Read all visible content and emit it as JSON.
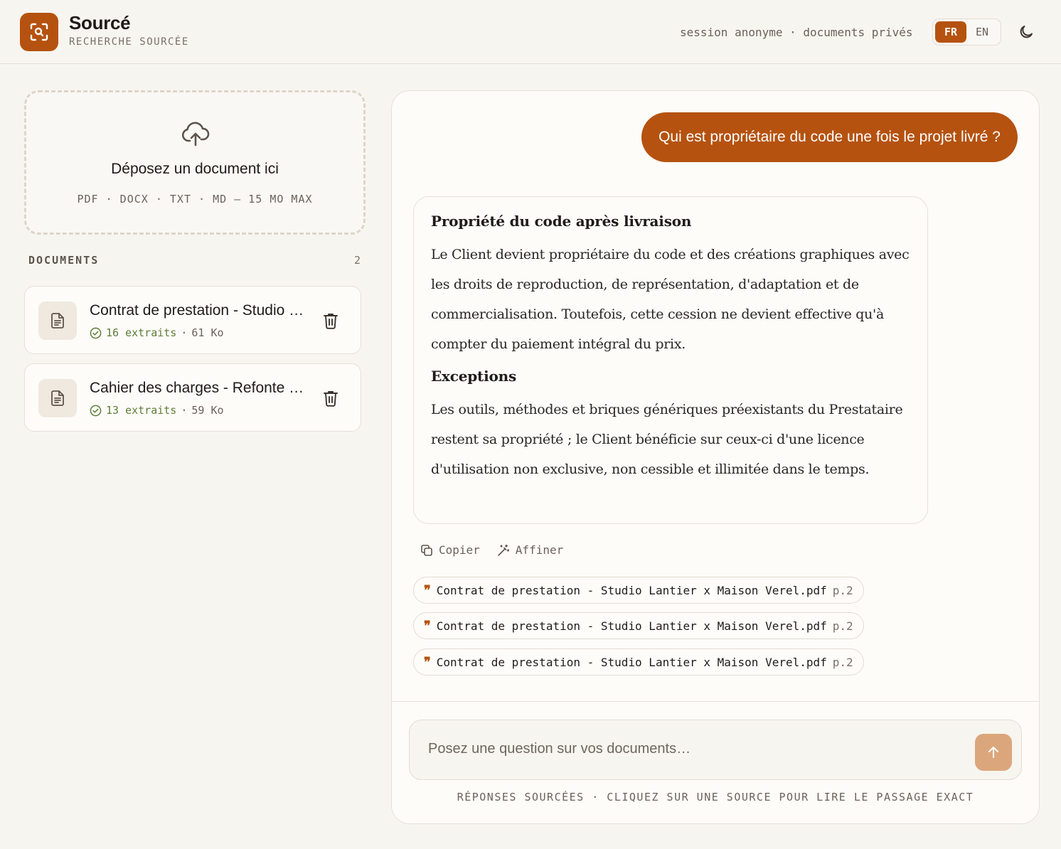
{
  "header": {
    "brand_title": "Sourcé",
    "brand_subtitle": "RECHERCHE SOURCÉE",
    "session_text": "session anonyme · documents privés",
    "languages": [
      {
        "label": "FR",
        "active": true
      },
      {
        "label": "EN",
        "active": false
      }
    ],
    "theme_icon": "moon-icon"
  },
  "upload": {
    "icon": "cloud-upload-icon",
    "title": "Déposez un document ici",
    "formats": "PDF · DOCX · TXT · MD — 15 MO MAX"
  },
  "documents": {
    "heading": "DOCUMENTS",
    "count": "2",
    "items": [
      {
        "name": "Contrat de prestation - Studio Lantier x Maison Verel.pdf",
        "extracts": "16 extraits",
        "separator": "·",
        "size": "61 Ko"
      },
      {
        "name": "Cahier des charges - Refonte du site.pdf",
        "extracts": "13 extraits",
        "separator": "·",
        "size": "59 Ko"
      }
    ]
  },
  "chat": {
    "user_question": "Qui est propriétaire du code une fois le projet livré ?",
    "answer": {
      "heading1": "Propriété du code après livraison",
      "paragraph1": "Le Client devient propriétaire du code et des créations graphiques avec les droits de reproduction, de représentation, d'adaptation et de commercialisation. Toutefois, cette cession ne devient effective qu'à compter du paiement intégral du prix.",
      "heading2": "Exceptions",
      "paragraph2": "Les outils, méthodes et briques génériques préexistants du Prestataire restent sa propriété ; le Client bénéficie sur ceux-ci d'une licence d'utilisation non exclusive, non cessible et illimitée dans le temps."
    },
    "actions": {
      "copy_label": "Copier",
      "refine_label": "Affiner"
    },
    "sources": [
      {
        "name": "Contrat de prestation - Studio Lantier x Maison Verel.pdf",
        "page": "p.2"
      },
      {
        "name": "Contrat de prestation - Studio Lantier x Maison Verel.pdf",
        "page": "p.2"
      },
      {
        "name": "Contrat de prestation - Studio Lantier x Maison Verel.pdf",
        "page": "p.2"
      }
    ],
    "input_placeholder": "Posez une question sur vos documents…",
    "footer_note": "RÉPONSES SOURCÉES · CLIQUEZ SUR UNE SOURCE POUR LIRE LE PASSAGE EXACT"
  },
  "colors": {
    "accent": "#b5520f",
    "background": "#f7f5f0",
    "success": "#5e7d38",
    "send_button": "#dca67c"
  }
}
